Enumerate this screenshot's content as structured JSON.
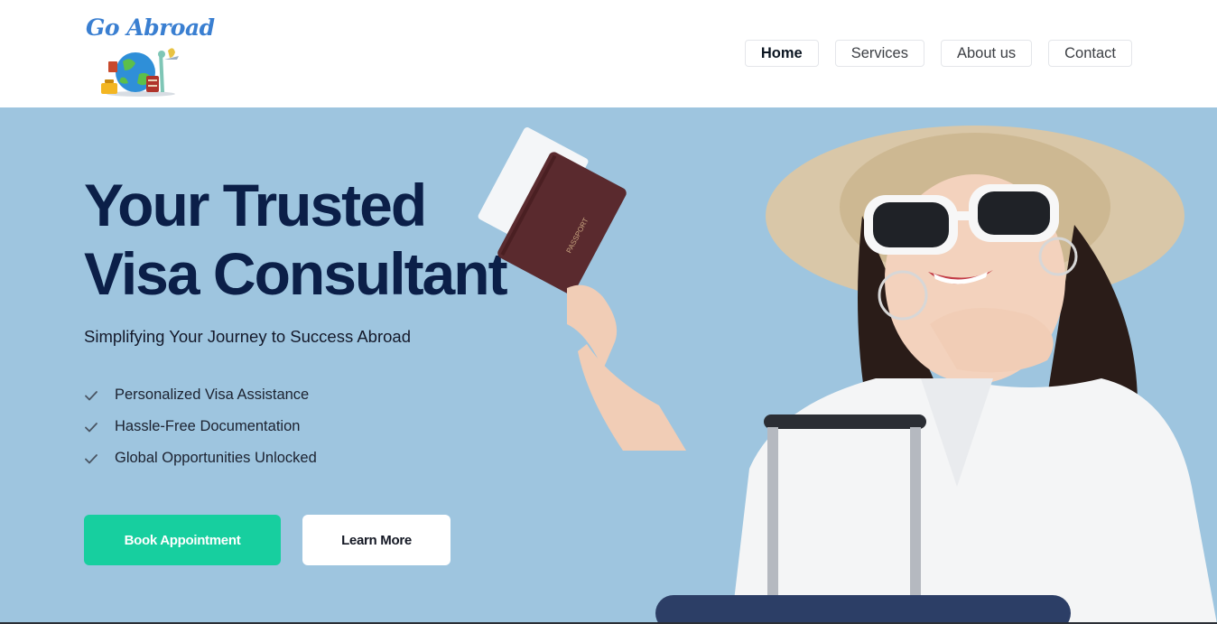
{
  "brand": {
    "logo_text": "Go Abroad",
    "logo_color": "#3a7fd1"
  },
  "nav": {
    "items": [
      {
        "label": "Home",
        "active": true
      },
      {
        "label": "Services",
        "active": false
      },
      {
        "label": "About us",
        "active": false
      },
      {
        "label": "Contact",
        "active": false
      }
    ]
  },
  "hero": {
    "headline_line1": "Your Trusted",
    "headline_line2": "Visa Consultant",
    "subtitle": "Simplifying Your Journey to Success Abroad",
    "features": [
      {
        "label": "Personalized Visa Assistance",
        "icon": "check-icon"
      },
      {
        "label": "Hassle-Free Documentation",
        "icon": "check-icon"
      },
      {
        "label": "Global Opportunities Unlocked",
        "icon": "check-icon"
      }
    ],
    "primary_button": "Book Appointment",
    "secondary_button": "Learn More",
    "passport_text": "PASSPORT",
    "colors": {
      "background": "#9ec5df",
      "headline": "#0b1f48",
      "primary_button": "#17cf9f"
    }
  }
}
